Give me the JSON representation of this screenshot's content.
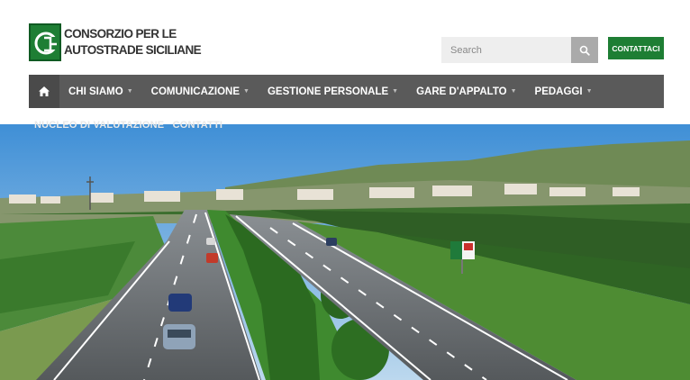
{
  "brand": {
    "line1": "CONSORZIO PER LE",
    "line2": "AUTOSTRADE SICILIANE"
  },
  "search": {
    "placeholder": "Search",
    "icon": "search-icon"
  },
  "contact_button": "CONTATTACI",
  "nav": {
    "home_icon": "home-icon",
    "items": [
      {
        "label": "CHI SIAMO"
      },
      {
        "label": "COMUNICAZIONE"
      },
      {
        "label": "GESTIONE PERSONALE"
      },
      {
        "label": "GARE D'APPALTO"
      },
      {
        "label": "PEDAGGI"
      }
    ]
  },
  "subnav": {
    "items": [
      "NUCLEO DI VALUTAZIONE",
      "CONTATTI"
    ]
  },
  "colors": {
    "brand_green": "#1e7e34",
    "nav_bg": "#5a5a5a"
  }
}
